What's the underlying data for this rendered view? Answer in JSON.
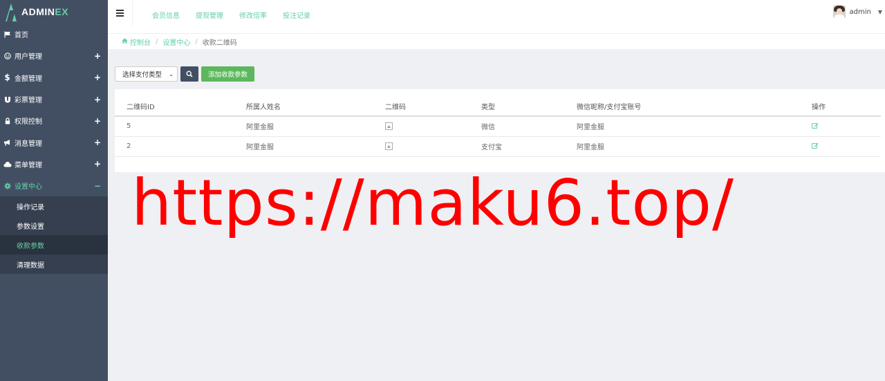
{
  "brand": {
    "name_main": "ADMIN",
    "name_accent": "EX"
  },
  "colors": {
    "accent": "#65cea7",
    "sidebar": "#424f63",
    "watermark": "#ff0000",
    "add_button": "#5cb85c"
  },
  "sidebar": {
    "items": [
      {
        "label": "首页",
        "icon": "flag-icon",
        "has_plus": false
      },
      {
        "label": "用户管理",
        "icon": "smile-icon",
        "has_plus": true
      },
      {
        "label": "金额管理",
        "icon": "dollar-icon",
        "has_plus": true
      },
      {
        "label": "彩票管理",
        "icon": "magnet-icon",
        "has_plus": true
      },
      {
        "label": "权限控制",
        "icon": "lock-icon",
        "has_plus": true
      },
      {
        "label": "消息管理",
        "icon": "bullhorn-icon",
        "has_plus": true
      },
      {
        "label": "菜单管理",
        "icon": "cloud-icon",
        "has_plus": true
      },
      {
        "label": "设置中心",
        "icon": "gear-icon",
        "expanded": true
      }
    ],
    "plus": "+",
    "minus": "−",
    "subitems": [
      "操作记录",
      "参数设置",
      "收款参数",
      "清理数据"
    ],
    "active_subitem": "收款参数"
  },
  "header": {
    "tabs": [
      "会员信息",
      "提现管理",
      "修改倍率",
      "投注记录"
    ],
    "user": "admin"
  },
  "breadcrumb": {
    "home": "控制台",
    "section": "设置中心",
    "current": "收款二维码"
  },
  "filter": {
    "select_value": "选择支付类型",
    "add_button": "添加收款参数"
  },
  "table": {
    "headers": [
      "二维码ID",
      "所属人姓名",
      "二维码",
      "类型",
      "微信昵称/支付宝账号",
      "操作"
    ],
    "rows": [
      {
        "id": "5",
        "owner": "阿里金服",
        "type": "微信",
        "account": "阿里金服"
      },
      {
        "id": "2",
        "owner": "阿里金服",
        "type": "支付宝",
        "account": "阿里金服"
      }
    ]
  },
  "watermark": "https://maku6.top/"
}
